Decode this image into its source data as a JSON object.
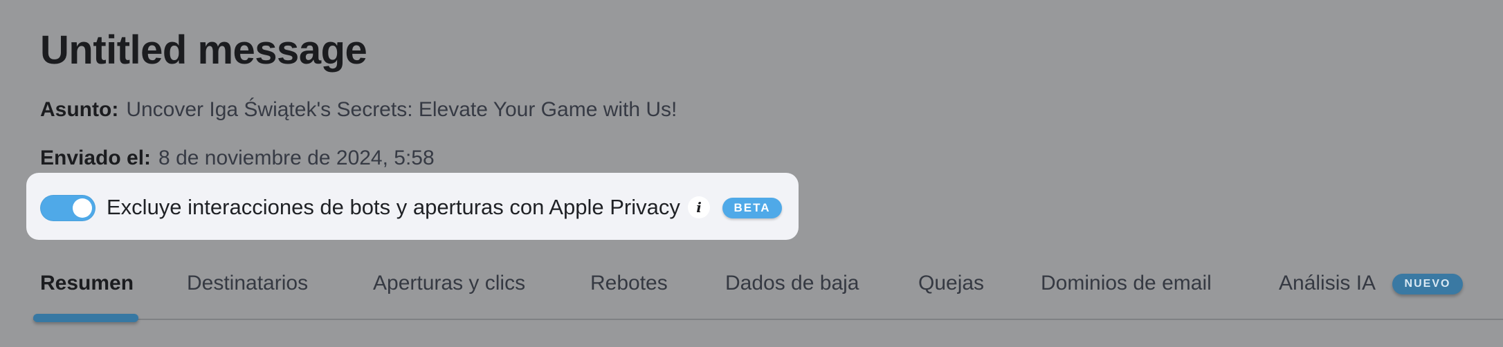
{
  "header": {
    "title": "Untitled message",
    "subject_label": "Asunto:",
    "subject_value": "Uncover Iga Świątek's Secrets: Elevate Your Game with Us!",
    "sent_label": "Enviado el:",
    "sent_value": "8 de noviembre de 2024, 5:58"
  },
  "privacy": {
    "toggle_on": true,
    "label": "Excluye interacciones de bots y aperturas con Apple Privacy",
    "info_icon": "info-icon",
    "info_glyph": "i",
    "badge": "BETA"
  },
  "tabs": [
    {
      "label": "Resumen",
      "active": true
    },
    {
      "label": "Destinatarios",
      "active": false
    },
    {
      "label": "Aperturas y clics",
      "active": false
    },
    {
      "label": "Rebotes",
      "active": false
    },
    {
      "label": "Dados de baja",
      "active": false
    },
    {
      "label": "Quejas",
      "active": false
    },
    {
      "label": "Dominios de email",
      "active": false
    },
    {
      "label": "Análisis IA",
      "active": false,
      "badge": "NUEVO"
    }
  ],
  "colors": {
    "overlay_background": "#98999b",
    "accent_blue": "#4fa9e8",
    "tab_active_underline": "#3778a3"
  }
}
